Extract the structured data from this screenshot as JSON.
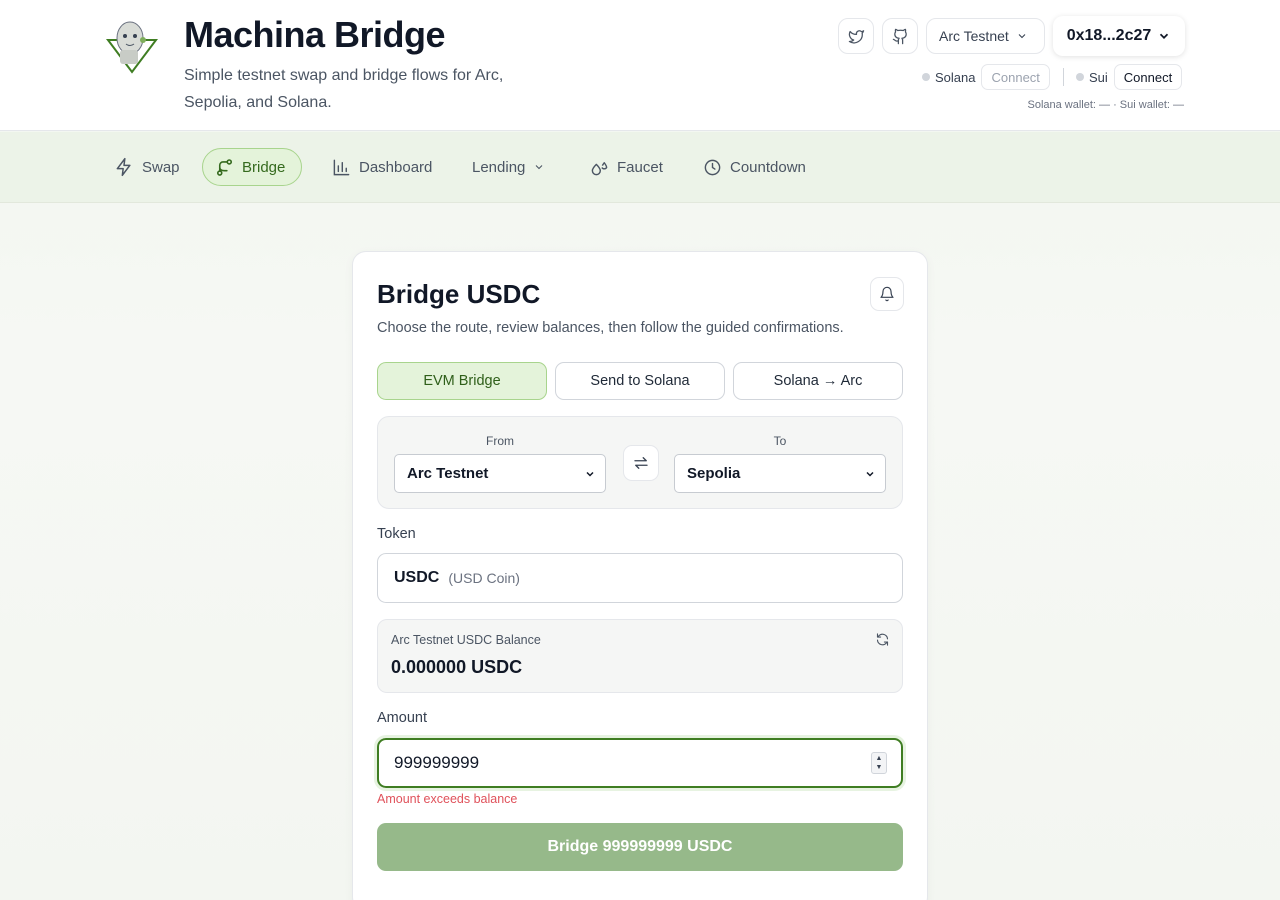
{
  "header": {
    "title": "Machina Bridge",
    "subtitle": "Simple testnet swap and bridge flows for Arc, Sepolia, and Solana.",
    "network": "Arc Testnet",
    "wallet_address": "0x18...2c27",
    "solana_label": "Solana",
    "solana_connect": "Connect",
    "sui_label": "Sui",
    "sui_connect": "Connect",
    "wallet_status": "Solana wallet: — · Sui wallet: —"
  },
  "nav": {
    "items": [
      {
        "label": "Swap",
        "icon": "lightning-icon"
      },
      {
        "label": "Bridge",
        "icon": "branch-icon",
        "active": true
      },
      {
        "label": "Dashboard",
        "icon": "bar-chart-icon"
      },
      {
        "label": "Lending",
        "icon": "chevron-down-icon"
      },
      {
        "label": "Faucet",
        "icon": "droplets-icon"
      },
      {
        "label": "Countdown",
        "icon": "clock-icon"
      }
    ]
  },
  "card": {
    "title": "Bridge USDC",
    "subtitle": "Choose the route, review balances, then follow the guided confirmations.",
    "modes": [
      "EVM Bridge",
      "Send to Solana",
      "Solana → Arc"
    ],
    "active_mode": "EVM Bridge",
    "from_label": "From",
    "from_value": "Arc Testnet",
    "to_label": "To",
    "to_value": "Sepolia",
    "token_label": "Token",
    "token_symbol": "USDC",
    "token_name": "(USD Coin)",
    "balance_label": "Arc Testnet USDC Balance",
    "balance_value": "0.000000 USDC",
    "amount_label": "Amount",
    "amount_value": "999999999",
    "error": "Amount exceeds balance",
    "submit_label": "Bridge 999999999 USDC"
  },
  "colors": {
    "accent": "#3f7d22",
    "accent_light": "#e4f3da",
    "button_disabled": "#96b98a",
    "error": "#e0525b"
  }
}
